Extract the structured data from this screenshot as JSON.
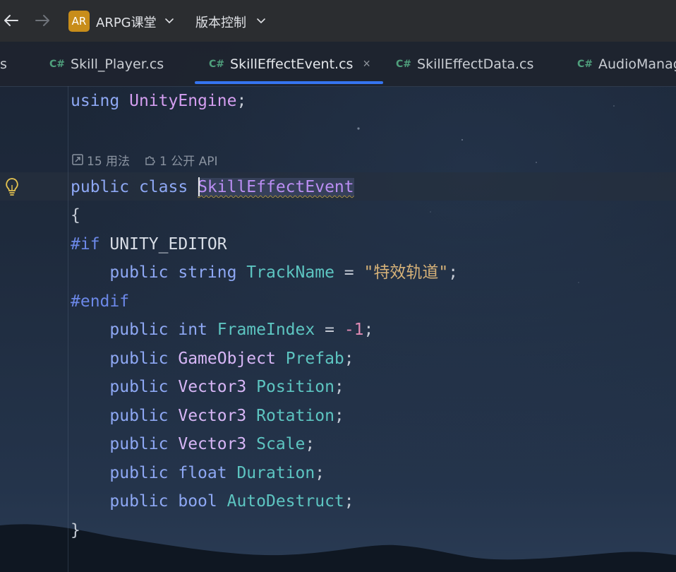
{
  "titlebar": {
    "project_badge": "AR",
    "project_name": "ARPG课堂",
    "vcs_label": "版本控制"
  },
  "tabs": [
    {
      "label": "s",
      "icon": "csharp-icon",
      "partial": true
    },
    {
      "label": "Skill_Player.cs",
      "icon": "csharp-icon"
    },
    {
      "label": "SkillEffectEvent.cs",
      "icon": "csharp-icon",
      "active": true
    },
    {
      "label": "SkillEffectData.cs",
      "icon": "csharp-icon"
    },
    {
      "label": "AudioManag",
      "icon": "csharp-icon"
    }
  ],
  "tab_icon_text": "C#",
  "close_glyph": "×",
  "inlay_hints": {
    "usages": "15 用法",
    "public_api": "1 公开 API"
  },
  "code": {
    "line1": {
      "kw": "using",
      "ns": "UnityEngine",
      "semi": ";"
    },
    "line_class": {
      "kw1": "public",
      "kw2": "class",
      "name": "SkillEffectEvent"
    },
    "open_brace": "{",
    "if_directive": {
      "pre": "#if",
      "sym": "UNITY_EDITOR"
    },
    "trackname": {
      "kw": "public",
      "type": "string",
      "field": "TrackName",
      "op": "=",
      "str": "\"特效轨道\"",
      "semi": ";"
    },
    "endif": "#endif",
    "frameindex": {
      "kw": "public",
      "type": "int",
      "field": "FrameIndex",
      "op": "=",
      "num": "-1",
      "semi": ";"
    },
    "prefab": {
      "kw": "public",
      "type": "GameObject",
      "field": "Prefab",
      "semi": ";"
    },
    "position": {
      "kw": "public",
      "type": "Vector3",
      "field": "Position",
      "semi": ";"
    },
    "rotation": {
      "kw": "public",
      "type": "Vector3",
      "field": "Rotation",
      "semi": ";"
    },
    "scale": {
      "kw": "public",
      "type": "Vector3",
      "field": "Scale",
      "semi": ";"
    },
    "duration": {
      "kw": "public",
      "type": "float",
      "field": "Duration",
      "semi": ";"
    },
    "autodestruct": {
      "kw": "public",
      "type": "bool",
      "field": "AutoDestruct",
      "semi": ";"
    },
    "close_brace": "}"
  },
  "colors": {
    "accent_tab_underline": "#3574f0",
    "project_badge": "#c88d1a"
  }
}
